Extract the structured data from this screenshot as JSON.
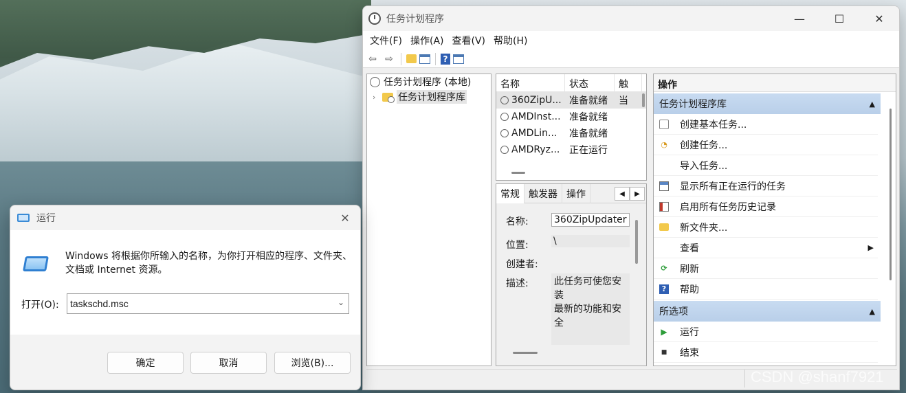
{
  "task_scheduler": {
    "title": "任务计划程序",
    "controls": {
      "minimize": "—",
      "maximize": "☐",
      "close": "✕"
    },
    "menu": [
      "文件(F)",
      "操作(A)",
      "查看(V)",
      "帮助(H)"
    ],
    "tree": {
      "root": "任务计划程序 (本地)",
      "library": "任务计划程序库"
    },
    "list": {
      "columns": [
        "名称",
        "状态",
        "触"
      ],
      "rows": [
        {
          "name": "360ZipU...",
          "status": "准备就绪",
          "trigger": "当"
        },
        {
          "name": "AMDInst...",
          "status": "准备就绪",
          "trigger": ""
        },
        {
          "name": "AMDLin...",
          "status": "准备就绪",
          "trigger": ""
        },
        {
          "name": "AMDRyz...",
          "status": "正在运行",
          "trigger": ""
        }
      ]
    },
    "details": {
      "tabs": [
        "常规",
        "触发器",
        "操作"
      ],
      "name_label": "名称:",
      "name_value": "360ZipUpdater",
      "location_label": "位置:",
      "location_value": "\\",
      "author_label": "创建者:",
      "desc_label": "描述:",
      "desc_line1": "此任务可使您安装",
      "desc_line2": "最新的功能和安全"
    },
    "actions": {
      "header": "操作",
      "section1": "任务计划程序库",
      "items1": [
        {
          "label": "创建基本任务...",
          "icon": "basic-task-icon"
        },
        {
          "label": "创建任务...",
          "icon": "task-icon"
        },
        {
          "label": "导入任务...",
          "icon": ""
        },
        {
          "label": "显示所有正在运行的任务",
          "icon": "running-tasks-icon"
        },
        {
          "label": "启用所有任务历史记录",
          "icon": "history-icon"
        },
        {
          "label": "新文件夹...",
          "icon": "new-folder-icon"
        },
        {
          "label": "查看",
          "icon": ""
        },
        {
          "label": "刷新",
          "icon": "refresh-icon"
        },
        {
          "label": "帮助",
          "icon": "help-icon"
        }
      ],
      "section2": "所选项",
      "items2": [
        {
          "label": "运行",
          "icon": "run-icon"
        },
        {
          "label": "结束",
          "icon": "stop-icon"
        }
      ]
    }
  },
  "run_dialog": {
    "title": "运行",
    "description": "Windows 将根据你所输入的名称，为你打开相应的程序、文件夹、文档或 Internet 资源。",
    "open_label": "打开(O):",
    "input_value": "taskschd.msc",
    "buttons": {
      "ok": "确定",
      "cancel": "取消",
      "browse": "浏览(B)..."
    }
  },
  "watermark": "CSDN @shanf7921"
}
